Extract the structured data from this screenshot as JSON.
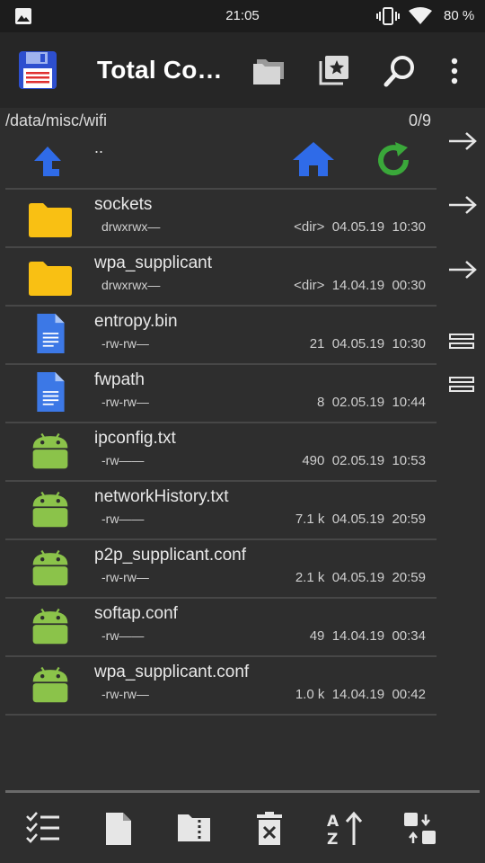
{
  "status_bar": {
    "time": "21:05",
    "battery": "80 %",
    "icons": [
      "image-icon",
      "vibrate-icon",
      "wifi-icon"
    ]
  },
  "toolbar": {
    "title": "Total Co…",
    "icons": [
      "save-disk-icon",
      "folders-icon",
      "bookmarks-icon",
      "search-icon",
      "overflow-menu-icon"
    ]
  },
  "path": {
    "current": "/data/misc/wifi",
    "selection": "0/9"
  },
  "up_row": {
    "label": ".."
  },
  "files": [
    {
      "name": "sockets",
      "attrs": "drwxrwx—",
      "size": "<dir>",
      "date": "04.05.19",
      "time": "10:30",
      "type": "folder"
    },
    {
      "name": "wpa_supplicant",
      "attrs": "drwxrwx—",
      "size": "<dir>",
      "date": "14.04.19",
      "time": "00:30",
      "type": "folder"
    },
    {
      "name": "entropy.bin",
      "attrs": "-rw-rw—",
      "size": "21",
      "date": "04.05.19",
      "time": "10:30",
      "type": "doc"
    },
    {
      "name": "fwpath",
      "attrs": "-rw-rw—",
      "size": "8",
      "date": "02.05.19",
      "time": "10:44",
      "type": "doc"
    },
    {
      "name": "ipconfig.txt",
      "attrs": "-rw——",
      "size": "490",
      "date": "02.05.19",
      "time": "10:53",
      "type": "android"
    },
    {
      "name": "networkHistory.txt",
      "attrs": "-rw——",
      "size": "7.1 k",
      "date": "04.05.19",
      "time": "20:59",
      "type": "android"
    },
    {
      "name": "p2p_supplicant.conf",
      "attrs": "-rw-rw—",
      "size": "2.1 k",
      "date": "04.05.19",
      "time": "20:59",
      "type": "android"
    },
    {
      "name": "softap.conf",
      "attrs": "-rw——",
      "size": "49",
      "date": "14.04.19",
      "time": "00:34",
      "type": "android"
    },
    {
      "name": "wpa_supplicant.conf",
      "attrs": "-rw-rw—",
      "size": "1.0 k",
      "date": "14.04.19",
      "time": "00:42",
      "type": "android"
    }
  ],
  "bottom_bar": {
    "icons": [
      "select-checklist-icon",
      "new-file-icon",
      "zip-folder-icon",
      "delete-icon",
      "sort-az-icon",
      "swap-panels-icon"
    ]
  },
  "colors": {
    "folder": "#f9c013",
    "doc": "#3c78e6",
    "android": "#8bc34a",
    "up_arrow": "#2f6be8",
    "home": "#2f6be8",
    "refresh": "#3aa83a",
    "save_disk": "#2d4fcf"
  }
}
